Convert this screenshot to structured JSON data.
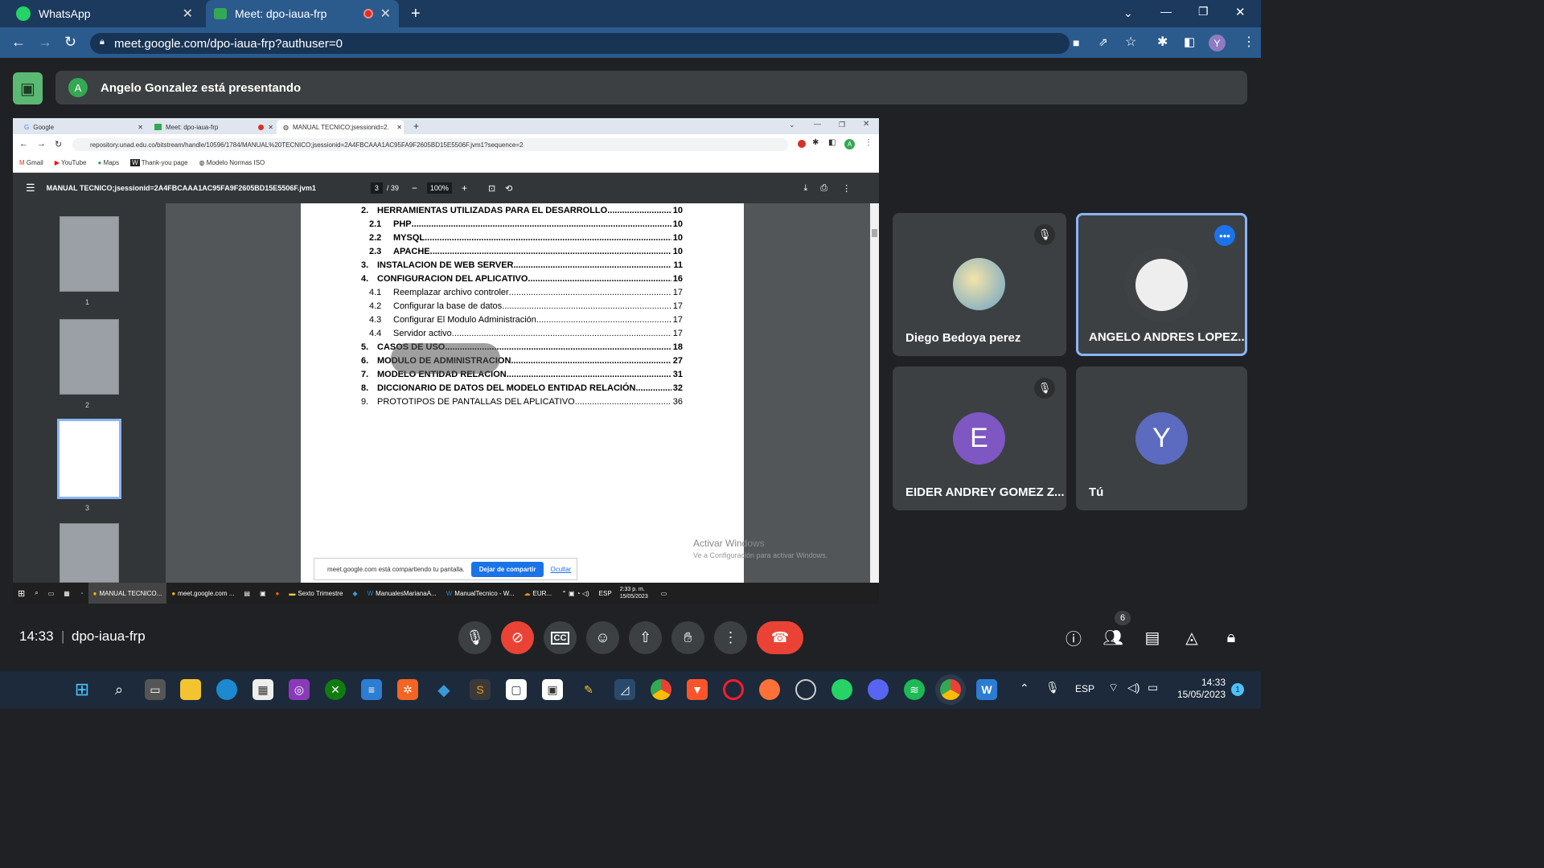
{
  "browser": {
    "tabs": [
      {
        "label": "WhatsApp",
        "active": false
      },
      {
        "label": "Meet: dpo-iaua-frp",
        "active": true
      }
    ],
    "new_tab": "+",
    "url": "meet.google.com/dpo-iaua-frp?authuser=0",
    "profile_initial": "Y"
  },
  "meet": {
    "presenter_initial": "A",
    "presenting_text": "Angelo Gonzalez está presentando",
    "clock": "14:33",
    "meeting_code": "dpo-iaua-frp",
    "participant_count": "6",
    "participants": [
      {
        "name": "Diego Bedoya perez",
        "muted": true
      },
      {
        "name": "ANGELO ANDRES LOPEZ...",
        "muted": false
      },
      {
        "name": "EIDER ANDREY GOMEZ Z...",
        "initial": "E",
        "muted": true,
        "color": "#7e57c2"
      },
      {
        "name": "Tú",
        "initial": "Y",
        "muted": false,
        "color": "#5c6bc0"
      }
    ]
  },
  "shared": {
    "tabs": [
      "Google",
      "Meet: dpo-iaua-frp",
      "MANUAL TECNICO;jsessionid=2..."
    ],
    "url": "repository.unad.edu.co/bitstream/handle/10596/1784/MANUAL%20TECNICO;jsessionid=2A4FBCAAA1AC95FA9F2605BD15E5506F.jvm1?sequence=2",
    "profile_initial": "A",
    "bookmarks": [
      "Gmail",
      "YouTube",
      "Maps",
      "Thank-you page",
      "Modelo Normas ISO"
    ],
    "pdf": {
      "title": "MANUAL TECNICO;jsessionid=2A4FBCAAA1AC95FA9F2605BD15E5506F.jvm1",
      "page": "3",
      "total": "/ 39",
      "zoom": "100%",
      "thumb_labels": [
        "1",
        "2",
        "3"
      ],
      "toc": [
        {
          "num": "2.",
          "text": "HERRAMIENTAS UTILIZADAS PARA EL DESARROLLO",
          "page": "10",
          "bold": true,
          "sub": false
        },
        {
          "num": "2.1",
          "text": "PHP",
          "page": "10",
          "bold": true,
          "sub": true
        },
        {
          "num": "2.2",
          "text": "MYSQL",
          "page": "10",
          "bold": true,
          "sub": true
        },
        {
          "num": "2.3",
          "text": "APACHE",
          "page": "10",
          "bold": true,
          "sub": true
        },
        {
          "num": "3.",
          "text": "INSTALACION DE WEB SERVER",
          "page": "11",
          "bold": true,
          "sub": false
        },
        {
          "num": "4.",
          "text": "CONFIGURACION DEL APLICATIVO",
          "page": "16",
          "bold": true,
          "sub": false
        },
        {
          "num": "4.1",
          "text": "Reemplazar archivo controler",
          "page": "17",
          "bold": false,
          "sub": true
        },
        {
          "num": "4.2",
          "text": "Configurar la base de datos",
          "page": "17",
          "bold": false,
          "sub": true
        },
        {
          "num": "4.3",
          "text": "Configurar El Modulo Administración",
          "page": "17",
          "bold": false,
          "sub": true
        },
        {
          "num": "4.4",
          "text": "Servidor activo",
          "page": "17",
          "bold": false,
          "sub": true
        },
        {
          "num": "5.",
          "text": "CASOS DE USO",
          "page": "18",
          "bold": true,
          "sub": false
        },
        {
          "num": "6.",
          "text": "MODULO DE ADMINISTRACION",
          "page": "27",
          "bold": true,
          "sub": false
        },
        {
          "num": "7.",
          "text": "MODELO ENTIDAD RELACION",
          "page": "31",
          "bold": true,
          "sub": false
        },
        {
          "num": "8.",
          "text": "DICCIONARIO DE DATOS DEL MODELO ENTIDAD RELACIÓN",
          "page": "32",
          "bold": true,
          "sub": false
        },
        {
          "num": "9.",
          "text": "PROTOTIPOS DE PANTALLAS DEL APLICATIVO",
          "page": "36",
          "bold": false,
          "sub": false
        }
      ]
    },
    "share_notice": "meet.google.com está compartiendo tu pantalla.",
    "stop_sharing": "Dejar de compartir",
    "hide": "Ocultar",
    "activate_title": "Activar Windows",
    "activate_sub": "Ve a Configuración para activar Windows.",
    "taskbar_items": [
      "MANUAL TECNICO...",
      "meet.google.com ...",
      "Sexto Trimestre",
      "ManualesMarianaA...",
      "ManualTecnico - W...",
      "EUR..."
    ],
    "lang": "ESP",
    "time": "2:33 p. m.",
    "date": "15/05/2023"
  },
  "taskbar": {
    "lang": "ESP",
    "time": "14:33",
    "date": "15/05/2023",
    "notif_count": "1"
  }
}
